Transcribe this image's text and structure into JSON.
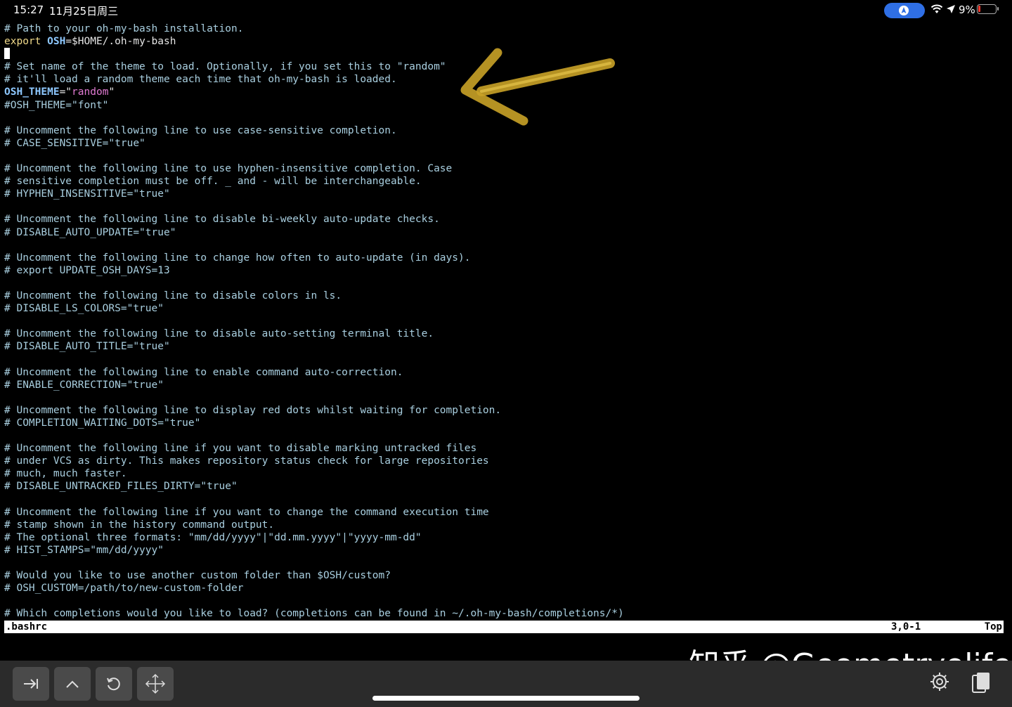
{
  "status_bar": {
    "time": "15:27",
    "date": "11月25日周三",
    "battery_percent": "9%",
    "battery_level": 0.09
  },
  "terminal_lines": [
    [
      {
        "t": "# Path to your oh-my-bash installation.",
        "c": "comment"
      }
    ],
    [
      {
        "t": "export",
        "c": "kw"
      },
      {
        "t": " ",
        "c": "plain"
      },
      {
        "t": "OSH",
        "c": "var"
      },
      {
        "t": "=$HOME/.oh-my-bash",
        "c": "plain"
      }
    ],
    [
      {
        "t": "",
        "c": "cursor"
      }
    ],
    [
      {
        "t": "# Set name of the theme to load. Optionally, if you set this to \"random\"",
        "c": "comment"
      }
    ],
    [
      {
        "t": "# it'll load a random theme each time that oh-my-bash is loaded.",
        "c": "comment"
      }
    ],
    [
      {
        "t": "OSH_THEME",
        "c": "var"
      },
      {
        "t": "=\"",
        "c": "plain"
      },
      {
        "t": "random",
        "c": "str"
      },
      {
        "t": "\"",
        "c": "plain"
      }
    ],
    [
      {
        "t": "#OSH_THEME=\"font\"",
        "c": "comment"
      }
    ],
    [
      {
        "t": "",
        "c": "plain"
      }
    ],
    [
      {
        "t": "# Uncomment the following line to use case-sensitive completion.",
        "c": "comment"
      }
    ],
    [
      {
        "t": "# CASE_SENSITIVE=\"true\"",
        "c": "comment"
      }
    ],
    [
      {
        "t": "",
        "c": "plain"
      }
    ],
    [
      {
        "t": "# Uncomment the following line to use hyphen-insensitive completion. Case",
        "c": "comment"
      }
    ],
    [
      {
        "t": "# sensitive completion must be off. _ and - will be interchangeable.",
        "c": "comment"
      }
    ],
    [
      {
        "t": "# HYPHEN_INSENSITIVE=\"true\"",
        "c": "comment"
      }
    ],
    [
      {
        "t": "",
        "c": "plain"
      }
    ],
    [
      {
        "t": "# Uncomment the following line to disable bi-weekly auto-update checks.",
        "c": "comment"
      }
    ],
    [
      {
        "t": "# DISABLE_AUTO_UPDATE=\"true\"",
        "c": "comment"
      }
    ],
    [
      {
        "t": "",
        "c": "plain"
      }
    ],
    [
      {
        "t": "# Uncomment the following line to change how often to auto-update (in days).",
        "c": "comment"
      }
    ],
    [
      {
        "t": "# export UPDATE_OSH_DAYS=13",
        "c": "comment"
      }
    ],
    [
      {
        "t": "",
        "c": "plain"
      }
    ],
    [
      {
        "t": "# Uncomment the following line to disable colors in ls.",
        "c": "comment"
      }
    ],
    [
      {
        "t": "# DISABLE_LS_COLORS=\"true\"",
        "c": "comment"
      }
    ],
    [
      {
        "t": "",
        "c": "plain"
      }
    ],
    [
      {
        "t": "# Uncomment the following line to disable auto-setting terminal title.",
        "c": "comment"
      }
    ],
    [
      {
        "t": "# DISABLE_AUTO_TITLE=\"true\"",
        "c": "comment"
      }
    ],
    [
      {
        "t": "",
        "c": "plain"
      }
    ],
    [
      {
        "t": "# Uncomment the following line to enable command auto-correction.",
        "c": "comment"
      }
    ],
    [
      {
        "t": "# ENABLE_CORRECTION=\"true\"",
        "c": "comment"
      }
    ],
    [
      {
        "t": "",
        "c": "plain"
      }
    ],
    [
      {
        "t": "# Uncomment the following line to display red dots whilst waiting for completion.",
        "c": "comment"
      }
    ],
    [
      {
        "t": "# COMPLETION_WAITING_DOTS=\"true\"",
        "c": "comment"
      }
    ],
    [
      {
        "t": "",
        "c": "plain"
      }
    ],
    [
      {
        "t": "# Uncomment the following line if you want to disable marking untracked files",
        "c": "comment"
      }
    ],
    [
      {
        "t": "# under VCS as dirty. This makes repository status check for large repositories",
        "c": "comment"
      }
    ],
    [
      {
        "t": "# much, much faster.",
        "c": "comment"
      }
    ],
    [
      {
        "t": "# DISABLE_UNTRACKED_FILES_DIRTY=\"true\"",
        "c": "comment"
      }
    ],
    [
      {
        "t": "",
        "c": "plain"
      }
    ],
    [
      {
        "t": "# Uncomment the following line if you want to change the command execution time",
        "c": "comment"
      }
    ],
    [
      {
        "t": "# stamp shown in the history command output.",
        "c": "comment"
      }
    ],
    [
      {
        "t": "# The optional three formats: \"mm/dd/yyyy\"|\"dd.mm.yyyy\"|\"yyyy-mm-dd\"",
        "c": "comment"
      }
    ],
    [
      {
        "t": "# HIST_STAMPS=\"mm/dd/yyyy\"",
        "c": "comment"
      }
    ],
    [
      {
        "t": "",
        "c": "plain"
      }
    ],
    [
      {
        "t": "# Would you like to use another custom folder than $OSH/custom?",
        "c": "comment"
      }
    ],
    [
      {
        "t": "# OSH_CUSTOM=/path/to/new-custom-folder",
        "c": "comment"
      }
    ],
    [
      {
        "t": "",
        "c": "plain"
      }
    ],
    [
      {
        "t": "# Which completions would you like to load? (completions can be found in ~/.oh-my-bash/completions/*)",
        "c": "comment"
      }
    ]
  ],
  "vim_status": {
    "filename": ".bashrc",
    "position": "3,0-1",
    "scroll": "Top"
  },
  "toolbar": {
    "buttons": [
      {
        "name": "tab-key-button",
        "icon": "tab-arrow-icon"
      },
      {
        "name": "ctrl-key-button",
        "icon": "caret-up-icon"
      },
      {
        "name": "refresh-button",
        "icon": "rotate-icon"
      },
      {
        "name": "move-button",
        "icon": "move-arrows-icon"
      }
    ],
    "right_icons": [
      "gear-icon",
      "clipboard-icon"
    ]
  },
  "watermark": "知乎 @Geometryolife",
  "colors": {
    "comment": "#a9cfe0",
    "keyword": "#f0d98a",
    "variable": "#8ec8ff",
    "string": "#e07ad2",
    "arrow": "#c9a227",
    "nav_pill": "#2f6fe5"
  }
}
